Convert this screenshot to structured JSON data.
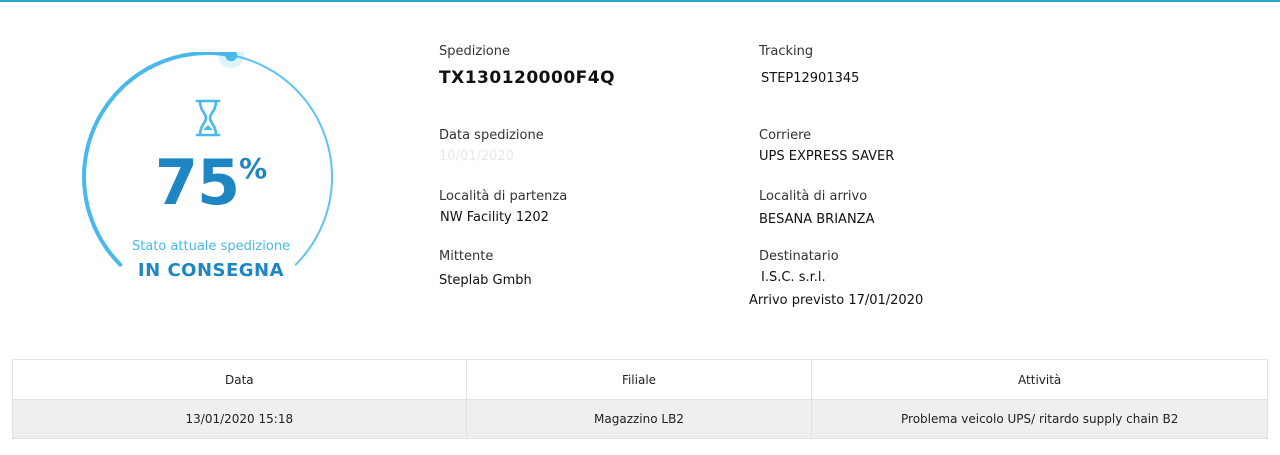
{
  "colors": {
    "accent": "#1f86c4",
    "accent_light": "#48b9ea",
    "gauge_track": "#5bc4f2",
    "top_border": "#2aa3c9",
    "row_background": "#efefef"
  },
  "status": {
    "progress_percent": 75,
    "percent_number": "75",
    "percent_sign": "%",
    "label": "Stato attuale spedizione",
    "value": "IN CONSEGNA",
    "icon": "hourglass-icon"
  },
  "shipment": {
    "spedizione_label": "Spedizione",
    "spedizione_value": "TX130120000F4Q",
    "tracking_label": "Tracking",
    "tracking_value": "STEP12901345",
    "data_label": "Data spedizione",
    "data_value": "10/01/2020",
    "corriere_label": "Corriere",
    "corriere_value": "UPS EXPRESS SAVER",
    "partenza_label": "Località di partenza",
    "partenza_value": "NW Facility 1202",
    "arrivo_label": "Località di arrivo",
    "arrivo_value": "BESANA BRIANZA",
    "mittente_label": "Mittente",
    "mittente_value": "Steplab Gmbh",
    "destinatario_label": "Destinatario",
    "destinatario_value": "I.S.C. s.r.l.",
    "arrivo_previsto": "Arrivo previsto 17/01/2020"
  },
  "events": {
    "headers": [
      "Data",
      "Filiale",
      "Attività"
    ],
    "rows": [
      [
        "13/01/2020 15:18",
        "Magazzino LB2",
        "Problema veicolo UPS/ ritardo supply chain B2"
      ]
    ]
  }
}
